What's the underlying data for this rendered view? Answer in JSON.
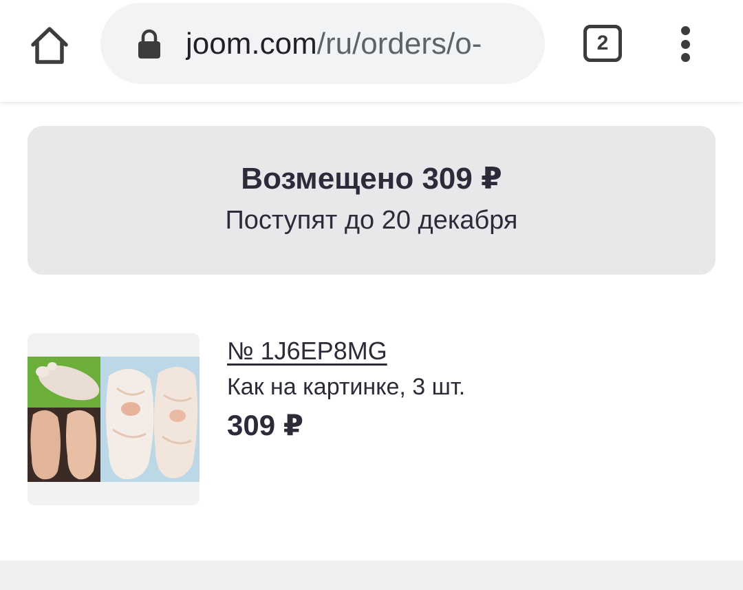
{
  "browser": {
    "url_host": "joom.com",
    "url_path": "/ru/orders/o-",
    "tab_count": "2",
    "icons": {
      "home": "home-icon",
      "lock": "lock-icon",
      "menu": "more-vert-icon"
    }
  },
  "refund": {
    "title": "Возмещено 309 ₽",
    "subtitle": "Поступят до 20 декабря"
  },
  "order": {
    "number": "№ 1J6EP8MG",
    "variant": "Как на картинке, 3 шт.",
    "price": "309 ₽"
  },
  "colors": {
    "text": "#2b2b3a",
    "card_bg": "#e8e8eb",
    "url_bar_bg": "#f1f3f4"
  }
}
